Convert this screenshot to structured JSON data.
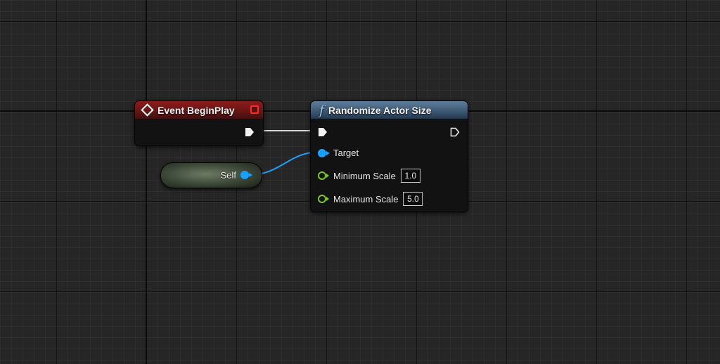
{
  "nodes": {
    "event_begin_play": {
      "title": "Event BeginPlay",
      "header_color": "#8c1c1c",
      "icon": "event-diamond-icon",
      "delegate_pin_color": "#ff2a2a"
    },
    "randomize_actor_size": {
      "title": "Randomize Actor Size",
      "header_color": "#4a6a8a",
      "icon_glyph": "f",
      "icon": "function-icon",
      "pins": {
        "target": {
          "label": "Target",
          "color": "#18a0ff"
        },
        "minimum_scale": {
          "label": "Minimum Scale",
          "value": "1.0",
          "color": "#7ac623"
        },
        "maximum_scale": {
          "label": "Maximum Scale",
          "value": "5.0",
          "color": "#7ac623"
        }
      }
    },
    "self": {
      "label": "Self",
      "pin_color": "#18a0ff"
    }
  },
  "wires": {
    "exec_color": "#d8d8d8",
    "object_color": "#18a0ff"
  },
  "canvas": {
    "background": "#262626"
  }
}
